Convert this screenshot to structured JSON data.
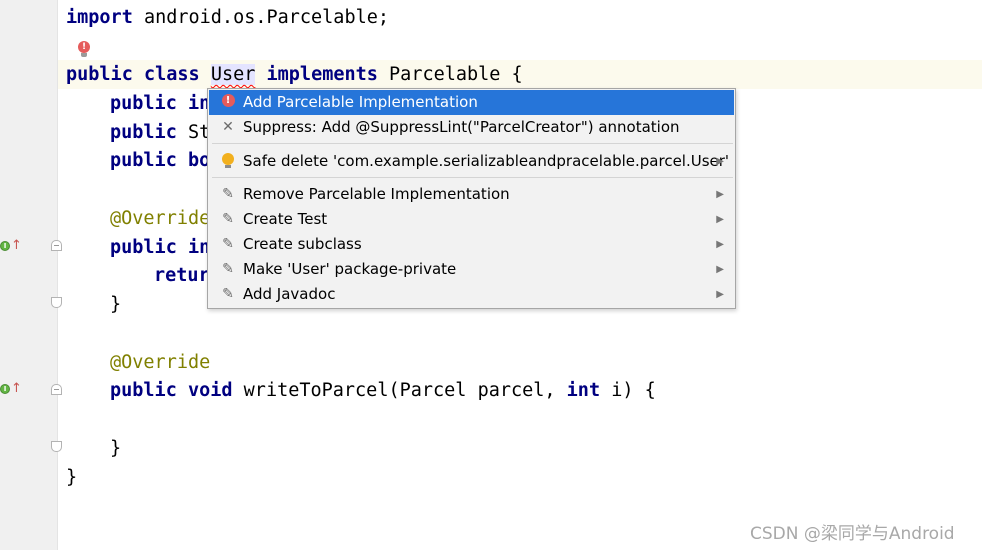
{
  "code": {
    "import_keyword": "import",
    "import_path": " android.os.Parcelable;",
    "line_class": {
      "public": "public",
      "class": "class",
      "class_name": "User",
      "implements": "implements",
      "rest": " Parcelable {"
    },
    "line_field1": {
      "public": "public",
      "rest": " in"
    },
    "line_field2": {
      "public": "public",
      "rest": " St"
    },
    "line_field3": {
      "public": "public",
      "rest": " bo"
    },
    "line_override1": "@Override",
    "line_method1": {
      "public": "public",
      "rest": " in"
    },
    "line_return": {
      "keyword": "retur"
    },
    "line_close1": "}",
    "line_override2": "@Override",
    "line_method2": {
      "public": "public",
      "void": "void",
      "mid": " writeToParcel(Parcel parcel, ",
      "int": "int",
      "end": " i) {"
    },
    "line_close2": "}",
    "line_close3": "}"
  },
  "context_menu": {
    "items": [
      {
        "label": "Add Parcelable Implementation",
        "icon": "error-icon",
        "selected": true,
        "submenu": false
      },
      {
        "label": "Suppress: Add @SuppressLint(\"ParcelCreator\") annotation",
        "icon": "close-icon",
        "selected": false,
        "submenu": false
      },
      {
        "label": "Safe delete 'com.example.serializableandpracelable.parcel.User'",
        "icon": "lightbulb-icon",
        "selected": false,
        "submenu": true
      },
      {
        "label": "Remove Parcelable Implementation",
        "icon": "pencil-icon",
        "selected": false,
        "submenu": true
      },
      {
        "label": "Create Test",
        "icon": "pencil-icon",
        "selected": false,
        "submenu": true
      },
      {
        "label": "Create subclass",
        "icon": "pencil-icon",
        "selected": false,
        "submenu": true
      },
      {
        "label": "Make 'User' package-private",
        "icon": "pencil-icon",
        "selected": false,
        "submenu": true
      },
      {
        "label": "Add Javadoc",
        "icon": "pencil-icon",
        "selected": false,
        "submenu": true
      }
    ]
  },
  "watermark": "CSDN @梁同学与Android",
  "colors": {
    "keyword": "#000080",
    "annotation": "#808000",
    "selection": "#2675d9",
    "error": "#e55b5b",
    "bulb": "#f2b01e",
    "current_line": "#fcfaed"
  }
}
